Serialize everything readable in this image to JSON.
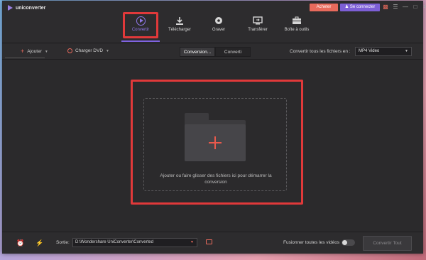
{
  "app": {
    "title": "uniconverter"
  },
  "header": {
    "buy_label": "Acheter",
    "login_label": "Se connecter",
    "window_icons": [
      "gift-icon",
      "menu-icon",
      "minimize-icon",
      "maximize-icon",
      "close-icon"
    ]
  },
  "nav": {
    "items": [
      {
        "label": "Convertir",
        "icon": "convert-icon",
        "active": true
      },
      {
        "label": "Télécharger",
        "icon": "download-icon"
      },
      {
        "label": "Graver",
        "icon": "burn-icon"
      },
      {
        "label": "Transférer",
        "icon": "transfer-icon"
      },
      {
        "label": "Boîte à outils",
        "icon": "toolbox-icon"
      }
    ]
  },
  "toolbar": {
    "add_label": "Ajouter",
    "load_dvd_label": "Charger DVD",
    "tabs": [
      "Conversion...",
      "Converti"
    ],
    "convert_all_label": "Convertir tous les fichiers en :",
    "format_value": "MP4 Video"
  },
  "drop_zone": {
    "text": "Ajouter ou faire glisser des fichiers ici pour démarrer la conversion"
  },
  "bottom": {
    "output_label": "Sortie:",
    "output_path": "D:\\Wondershare UniConverter\\Converted",
    "merge_label": "Fusionner toutes les vidéos",
    "merge_enabled": false,
    "convert_all_button": "Convertir Tout"
  },
  "colors": {
    "accent_purple": "#7f63e0",
    "accent_red": "#e86a5c",
    "highlight_red": "#e0393a",
    "background": "#2b2a2c"
  }
}
